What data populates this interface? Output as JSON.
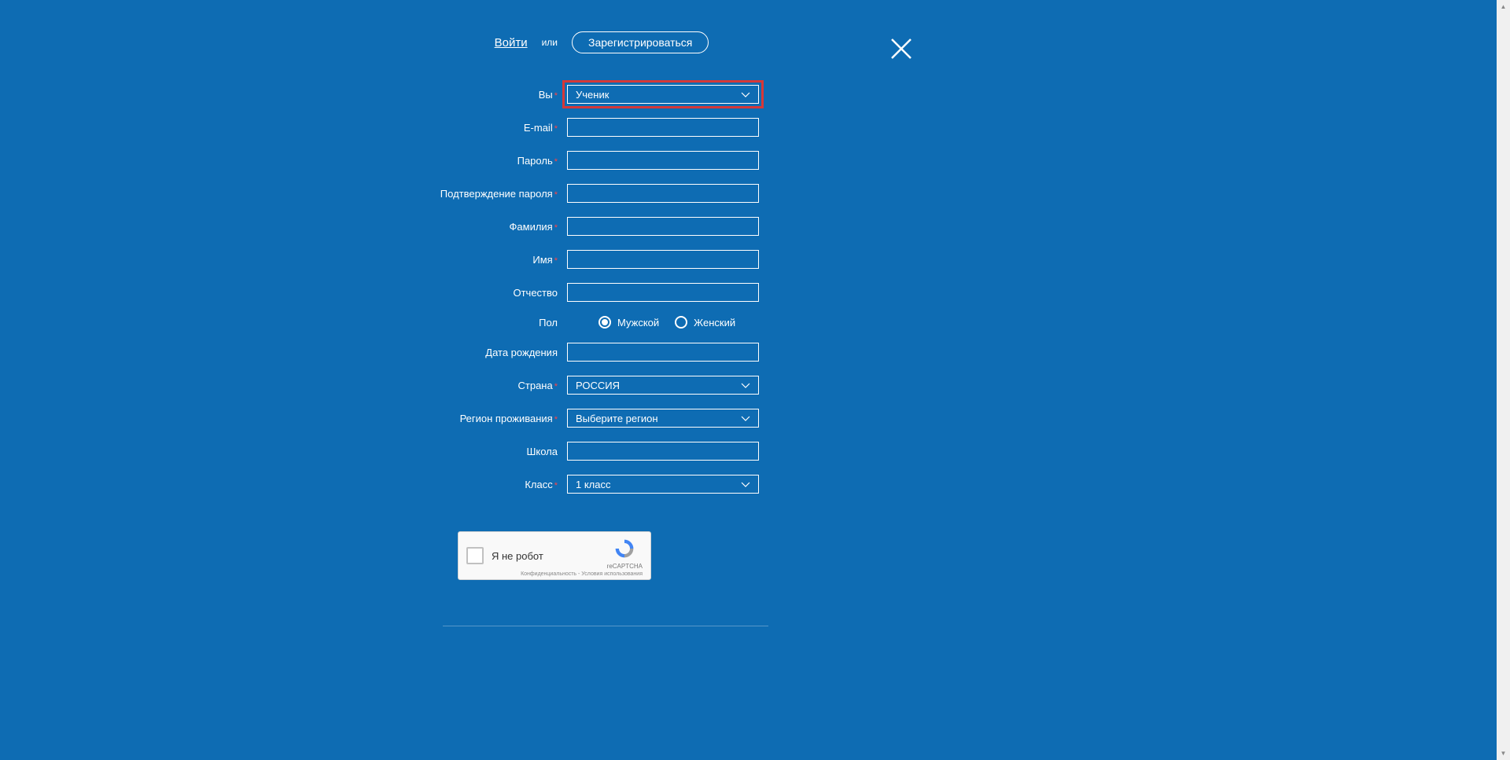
{
  "auth": {
    "login": "Войти",
    "or": "или",
    "register": "Зарегистрироваться"
  },
  "fields": {
    "role": {
      "label": "Вы",
      "value": "Ученик"
    },
    "email": {
      "label": "E-mail"
    },
    "password": {
      "label": "Пароль"
    },
    "password_confirm": {
      "label": "Подтверждение пароля"
    },
    "last_name": {
      "label": "Фамилия"
    },
    "first_name": {
      "label": "Имя"
    },
    "patronymic": {
      "label": "Отчество"
    },
    "gender": {
      "label": "Пол",
      "male": "Мужской",
      "female": "Женский"
    },
    "birthdate": {
      "label": "Дата рождения"
    },
    "country": {
      "label": "Страна",
      "value": "РОССИЯ"
    },
    "region": {
      "label": "Регион проживания",
      "placeholder": "Выберите регион"
    },
    "school": {
      "label": "Школа"
    },
    "grade": {
      "label": "Класс",
      "value": "1 класс"
    }
  },
  "captcha": {
    "text": "Я не робот",
    "brand": "reCAPTCHA",
    "footer": "Конфиденциальность - Условия использования"
  }
}
